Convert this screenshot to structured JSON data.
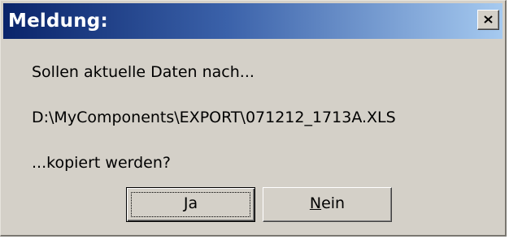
{
  "dialog": {
    "title": "Meldung:",
    "close_icon": "close-x-icon"
  },
  "message": {
    "line1": "Sollen aktuelle Daten nach...",
    "line2": "D:\\MyComponents\\EXPORT\\071212_1713A.XLS",
    "line3": "...kopiert werden?"
  },
  "buttons": {
    "yes": {
      "mnemonic": "J",
      "rest": "a"
    },
    "no": {
      "mnemonic": "N",
      "rest": "ein"
    }
  }
}
